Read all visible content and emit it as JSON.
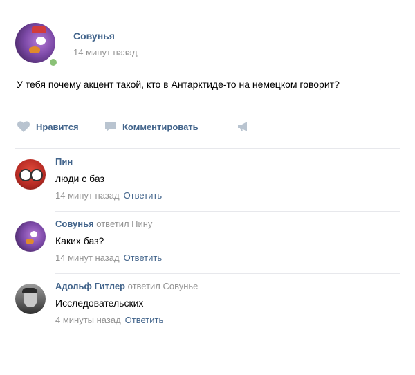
{
  "post": {
    "author": "Совунья",
    "time": "14 минут назад",
    "text": "У тебя почему акцент такой, кто в Антарктиде-то на немецком говорит?"
  },
  "actions": {
    "like_label": "Нравится",
    "comment_label": "Комментировать"
  },
  "comments": [
    {
      "author": "Пин",
      "reply_to": "",
      "text": "люди с баз",
      "time": "14 минут назад",
      "reply_label": "Ответить"
    },
    {
      "author": "Совунья",
      "reply_to": "ответил Пину",
      "text": "Каких баз?",
      "time": "14 минут назад",
      "reply_label": "Ответить"
    },
    {
      "author": "Адольф Гитлер",
      "reply_to": "ответил Совунье",
      "text": "Исследовательских",
      "time": "4 минуты назад",
      "reply_label": "Ответить"
    }
  ],
  "colors": {
    "link": "#42648b",
    "muted": "#939393",
    "icon": "#b9c4d0",
    "online": "#8ac176"
  }
}
